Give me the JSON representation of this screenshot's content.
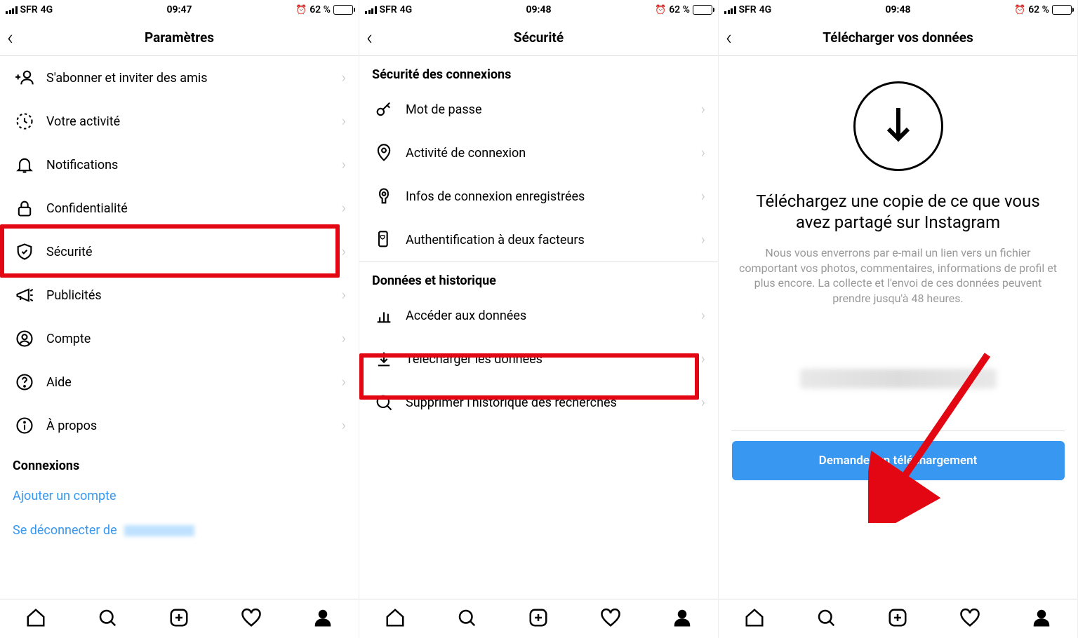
{
  "statusbar": {
    "carrier": "SFR",
    "network": "4G",
    "battery_percent": "62 %",
    "time1": "09:47",
    "time2": "09:48",
    "time3": "09:48"
  },
  "screen1": {
    "title": "Paramètres",
    "items": [
      {
        "label": "S'abonner et inviter des amis"
      },
      {
        "label": "Votre activité"
      },
      {
        "label": "Notifications"
      },
      {
        "label": "Confidentialité"
      },
      {
        "label": "Sécurité"
      },
      {
        "label": "Publicités"
      },
      {
        "label": "Compte"
      },
      {
        "label": "Aide"
      },
      {
        "label": "À propos"
      }
    ],
    "section_label": "Connexions",
    "link_add_account": "Ajouter un compte",
    "link_logout": "Se déconnecter de"
  },
  "screen2": {
    "title": "Sécurité",
    "section1_label": "Sécurité des connexions",
    "section1_items": [
      {
        "label": "Mot de passe"
      },
      {
        "label": "Activité de connexion"
      },
      {
        "label": "Infos de connexion enregistrées"
      },
      {
        "label": "Authentification à deux facteurs"
      }
    ],
    "section2_label": "Données et historique",
    "section2_items": [
      {
        "label": "Accéder aux données"
      },
      {
        "label": "Télécharger les données"
      },
      {
        "label": "Supprimer l'historique des recherches"
      }
    ]
  },
  "screen3": {
    "title": "Télécharger vos données",
    "heading": "Téléchargez une copie de ce que vous avez partagé sur Instagram",
    "description": "Nous vous enverrons par e-mail un lien vers un fichier comportant vos photos, commentaires, informations de profil et plus encore. La collecte et l'envoi de ces données peuvent prendre jusqu'à 48 heures.",
    "button_label": "Demander un téléchargement"
  }
}
